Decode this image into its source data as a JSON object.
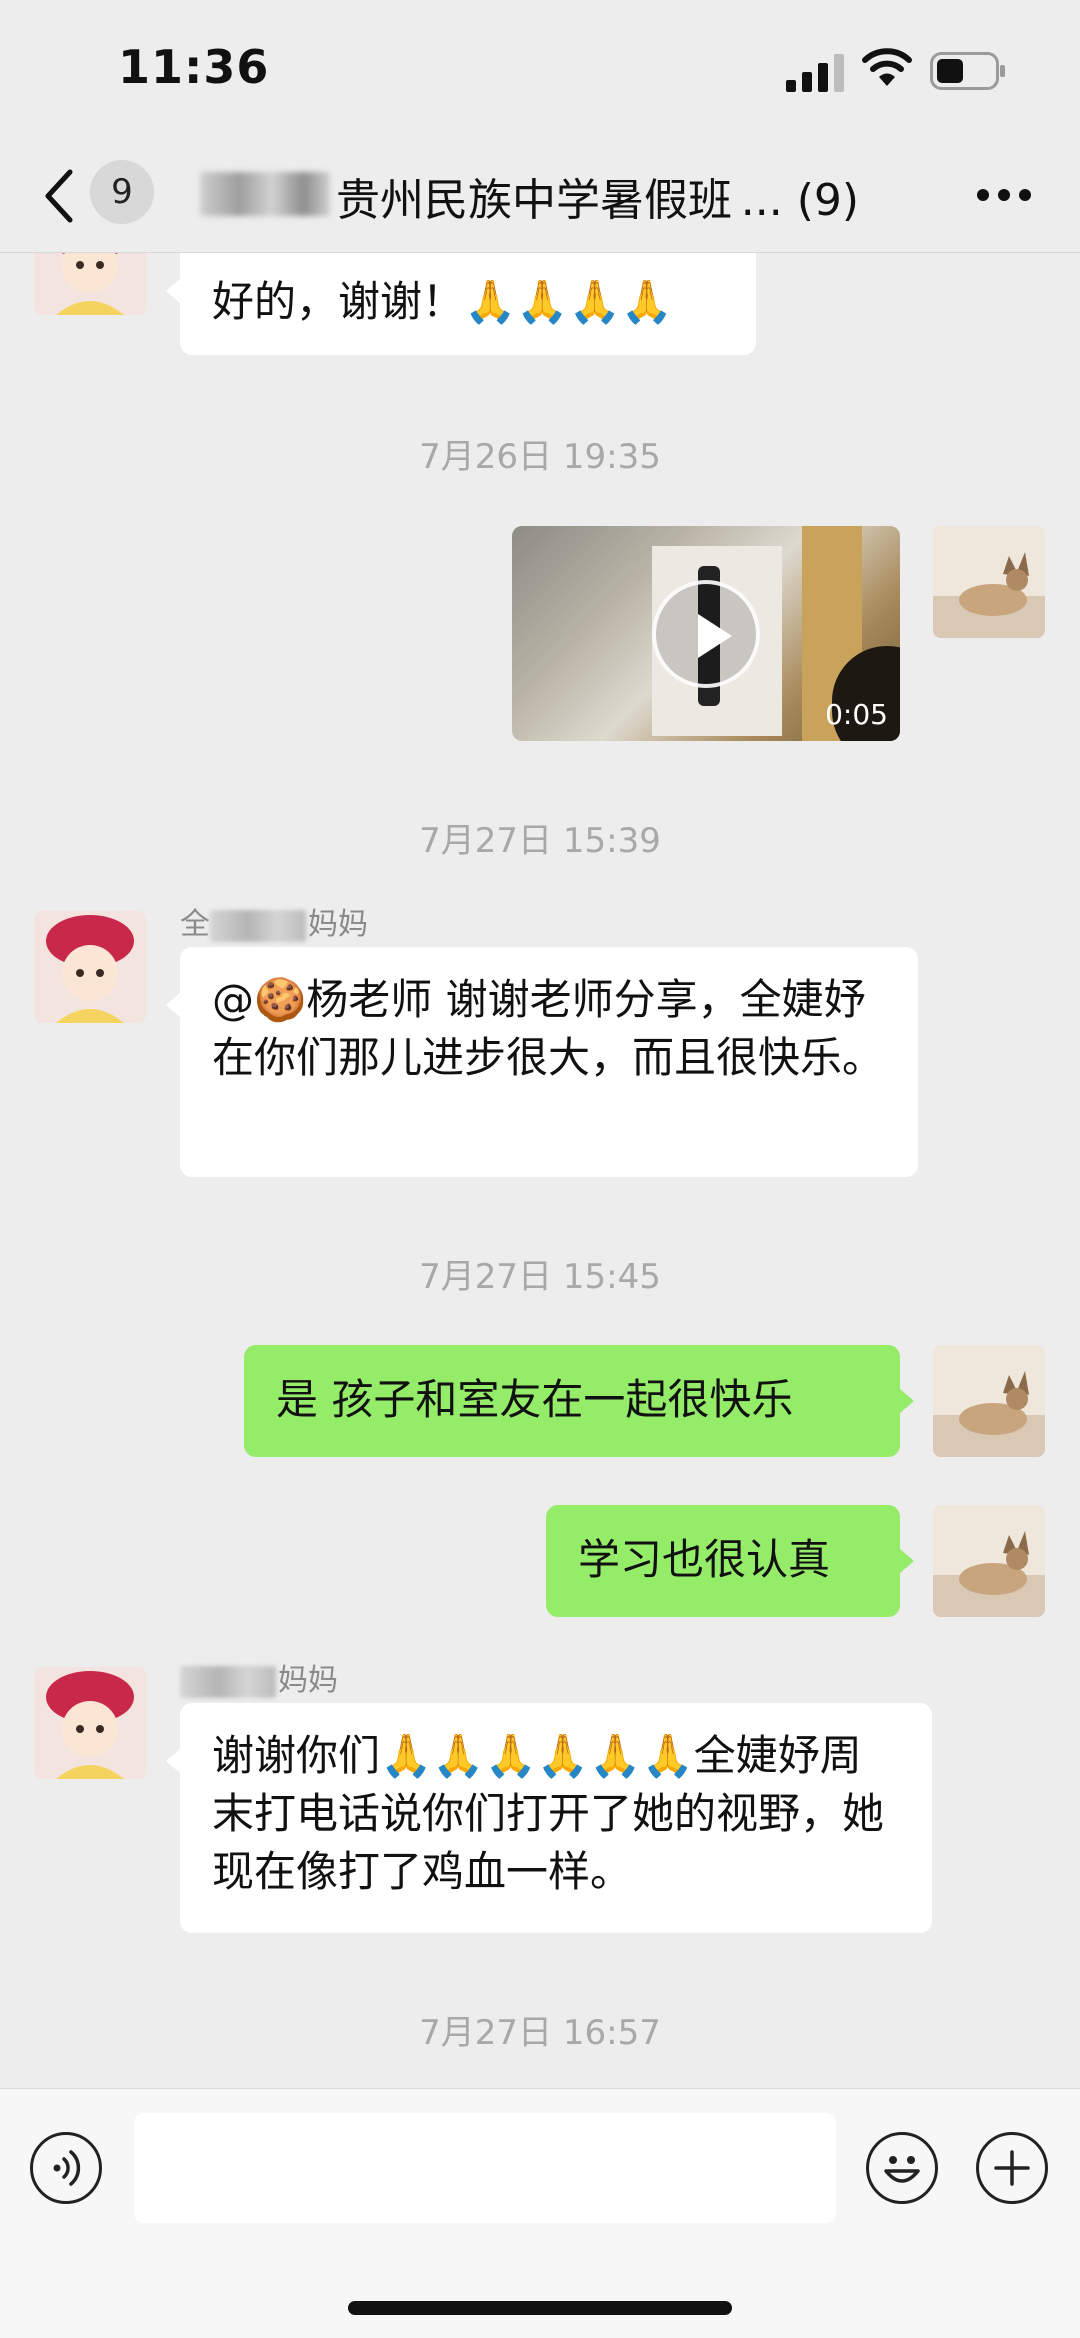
{
  "status_bar": {
    "time": "11:36"
  },
  "nav": {
    "back_count": "9",
    "title": "贵州民族中学暑假班 ... (9)"
  },
  "messages": [
    {
      "text": "好的，谢谢！🙏🙏🙏🙏"
    },
    {
      "timestamp": "7月26日 19:35"
    },
    {
      "video_duration": "0:05"
    },
    {
      "timestamp": "7月27日 15:39"
    },
    {
      "sender_prefix": "全",
      "sender_suffix": "妈妈",
      "mention": "@🍪杨老师",
      "text": " 谢谢老师分享，全婕妤在你们那儿进步很大，而且很快乐。"
    },
    {
      "timestamp": "7月27日 15:45"
    },
    {
      "text": "是 孩子和室友在一起很快乐"
    },
    {
      "text": "学习也很认真"
    },
    {
      "sender_suffix": "妈妈",
      "text": "谢谢你们🙏🙏🙏🙏🙏🙏全婕妤周末打电话说你们打开了她的视野，她现在像打了鸡血一样。"
    },
    {
      "timestamp": "7月27日 16:57"
    }
  ],
  "icons": {
    "back": "chevron-left-icon",
    "more": "more-dots-icon",
    "voice": "voice-icon",
    "emoji": "emoji-icon",
    "plus": "plus-icon",
    "play": "play-icon"
  },
  "colors": {
    "out_bubble": "#95ec69",
    "in_bubble": "#ffffff",
    "background": "#ededed"
  }
}
